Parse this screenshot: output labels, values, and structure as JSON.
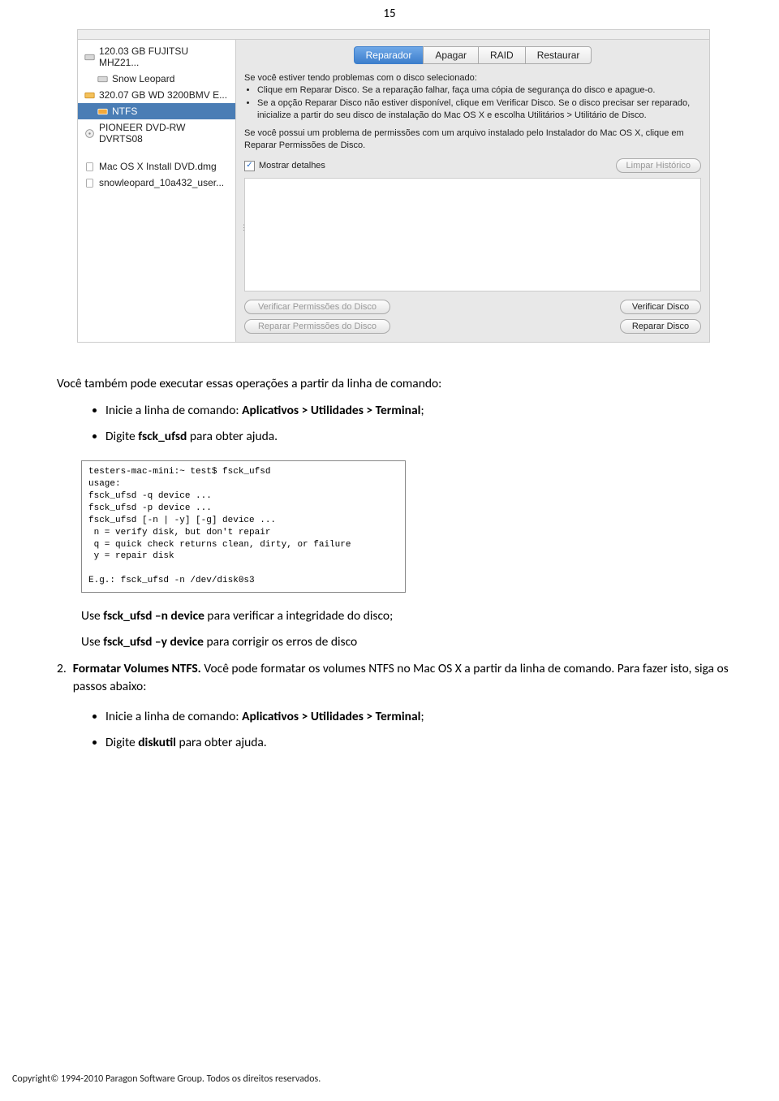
{
  "page_number": "15",
  "mac_window": {
    "sidebar": {
      "items": [
        {
          "label": "120.03 GB FUJITSU MHZ21...",
          "icon": "disk-icon"
        },
        {
          "label": "Snow Leopard",
          "icon": "disk-icon",
          "indent": true
        },
        {
          "label": "320.07 GB WD 3200BMV E...",
          "icon": "disk-ext-icon"
        },
        {
          "label": "NTFS",
          "icon": "disk-orange-icon",
          "indent": true,
          "selected": true
        },
        {
          "label": "PIONEER DVD-RW DVRTS08",
          "icon": "optical-icon"
        },
        {
          "label": "Mac OS X Install DVD.dmg",
          "icon": "dmg-icon"
        },
        {
          "label": "snowleopard_10a432_user...",
          "icon": "dmg-icon"
        }
      ]
    },
    "tabs": [
      {
        "label": "Reparador",
        "active": true
      },
      {
        "label": "Apagar"
      },
      {
        "label": "RAID"
      },
      {
        "label": "Restaurar"
      }
    ],
    "help1_intro": "Se você estiver tendo problemas com o disco selecionado:",
    "help1_bullets": [
      "Clique em Reparar Disco. Se a reparação falhar, faça uma cópia de segurança do disco e apague-o.",
      "Se a opção Reparar Disco não estiver disponível, clique em Verificar Disco. Se o disco precisar ser reparado, inicialize a partir do seu disco de instalação do Mac OS X e escolha Utilitários > Utilitário de Disco."
    ],
    "help2": "Se você possui um problema de permissões com um arquivo instalado pelo Instalador do Mac OS X, clique em Reparar Permissões de Disco.",
    "show_details": "Mostrar detalhes",
    "clear_history": "Limpar Histórico",
    "buttons": {
      "verify_perms": "Verificar Permissões do Disco",
      "repair_perms": "Reparar Permissões do Disco",
      "verify_disk": "Verificar Disco",
      "repair_disk": "Reparar Disco"
    }
  },
  "body": {
    "p1": "Você também pode executar essas operações a partir da linha de comando:",
    "b1_pre": "Inicie a linha de comando: ",
    "b1_bold": "Aplicativos > Utilidades > Terminal",
    "b1_post": ";",
    "b2_pre": "Digite ",
    "b2_bold": "fsck_ufsd",
    "b2_post": " para obter ajuda.",
    "terminal": "testers-mac-mini:~ test$ fsck_ufsd\nusage:\nfsck_ufsd -q device ...\nfsck_ufsd -p device ...\nfsck_ufsd [-n | -y] [-g] device ...\n n = verify disk, but don't repair\n q = quick check returns clean, dirty, or failure\n y = repair disk\n\nE.g.: fsck_ufsd -n /dev/disk0s3",
    "p2_pre": "Use ",
    "p2_bold": "fsck_ufsd –n device",
    "p2_post": " para verificar a integridade do disco;",
    "p3_pre": "Use ",
    "p3_bold": "fsck_ufsd –y device",
    "p3_post": " para corrigir os erros de disco",
    "li2_num": "2.",
    "li2_bold": "Formatar Volumes NTFS.",
    "li2_rest": " Você pode formatar os volumes NTFS no Mac OS X a partir da linha de comando. Para fazer isto, siga os passos abaixo:",
    "b3_pre": "Inicie a linha de comando: ",
    "b3_bold": "Aplicativos > Utilidades > Terminal",
    "b3_post": ";",
    "b4_pre": "Digite ",
    "b4_bold": "diskutil",
    "b4_post": " para obter ajuda."
  },
  "footer": "Copyright© 1994-2010 Paragon Software Group. Todos os direitos reservados."
}
